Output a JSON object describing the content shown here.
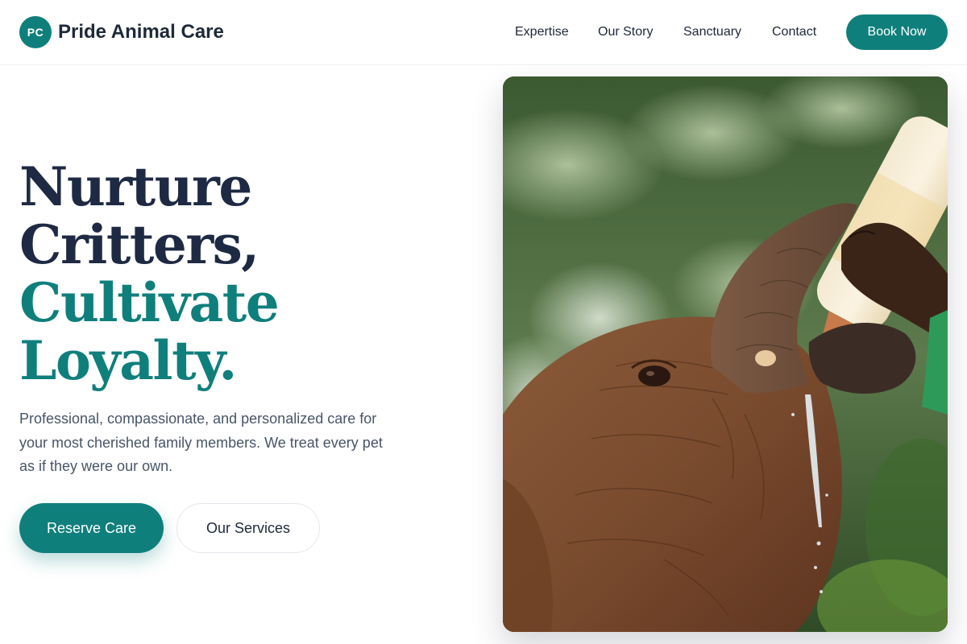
{
  "brand": {
    "initials": "PC",
    "name": "Pride Animal Care"
  },
  "nav": {
    "items": [
      {
        "label": "Expertise"
      },
      {
        "label": "Our Story"
      },
      {
        "label": "Sanctuary"
      },
      {
        "label": "Contact"
      }
    ],
    "cta_label": "Book Now"
  },
  "hero": {
    "headline_line1": "Nurture",
    "headline_line2": "Critters,",
    "headline_line3": "Cultivate",
    "headline_line4": "Loyalty.",
    "lead": "Professional, compassionate, and personalized care for your most cherished family members. We treat every pet as if they were our own.",
    "primary_cta": "Reserve Care",
    "secondary_cta": "Our Services",
    "image_subject": "baby elephant drinking from a milk bottle held by a caretaker"
  },
  "colors": {
    "accent": "#0f7f7c",
    "headline_dark": "#1e2a44",
    "body_text": "#475569"
  }
}
